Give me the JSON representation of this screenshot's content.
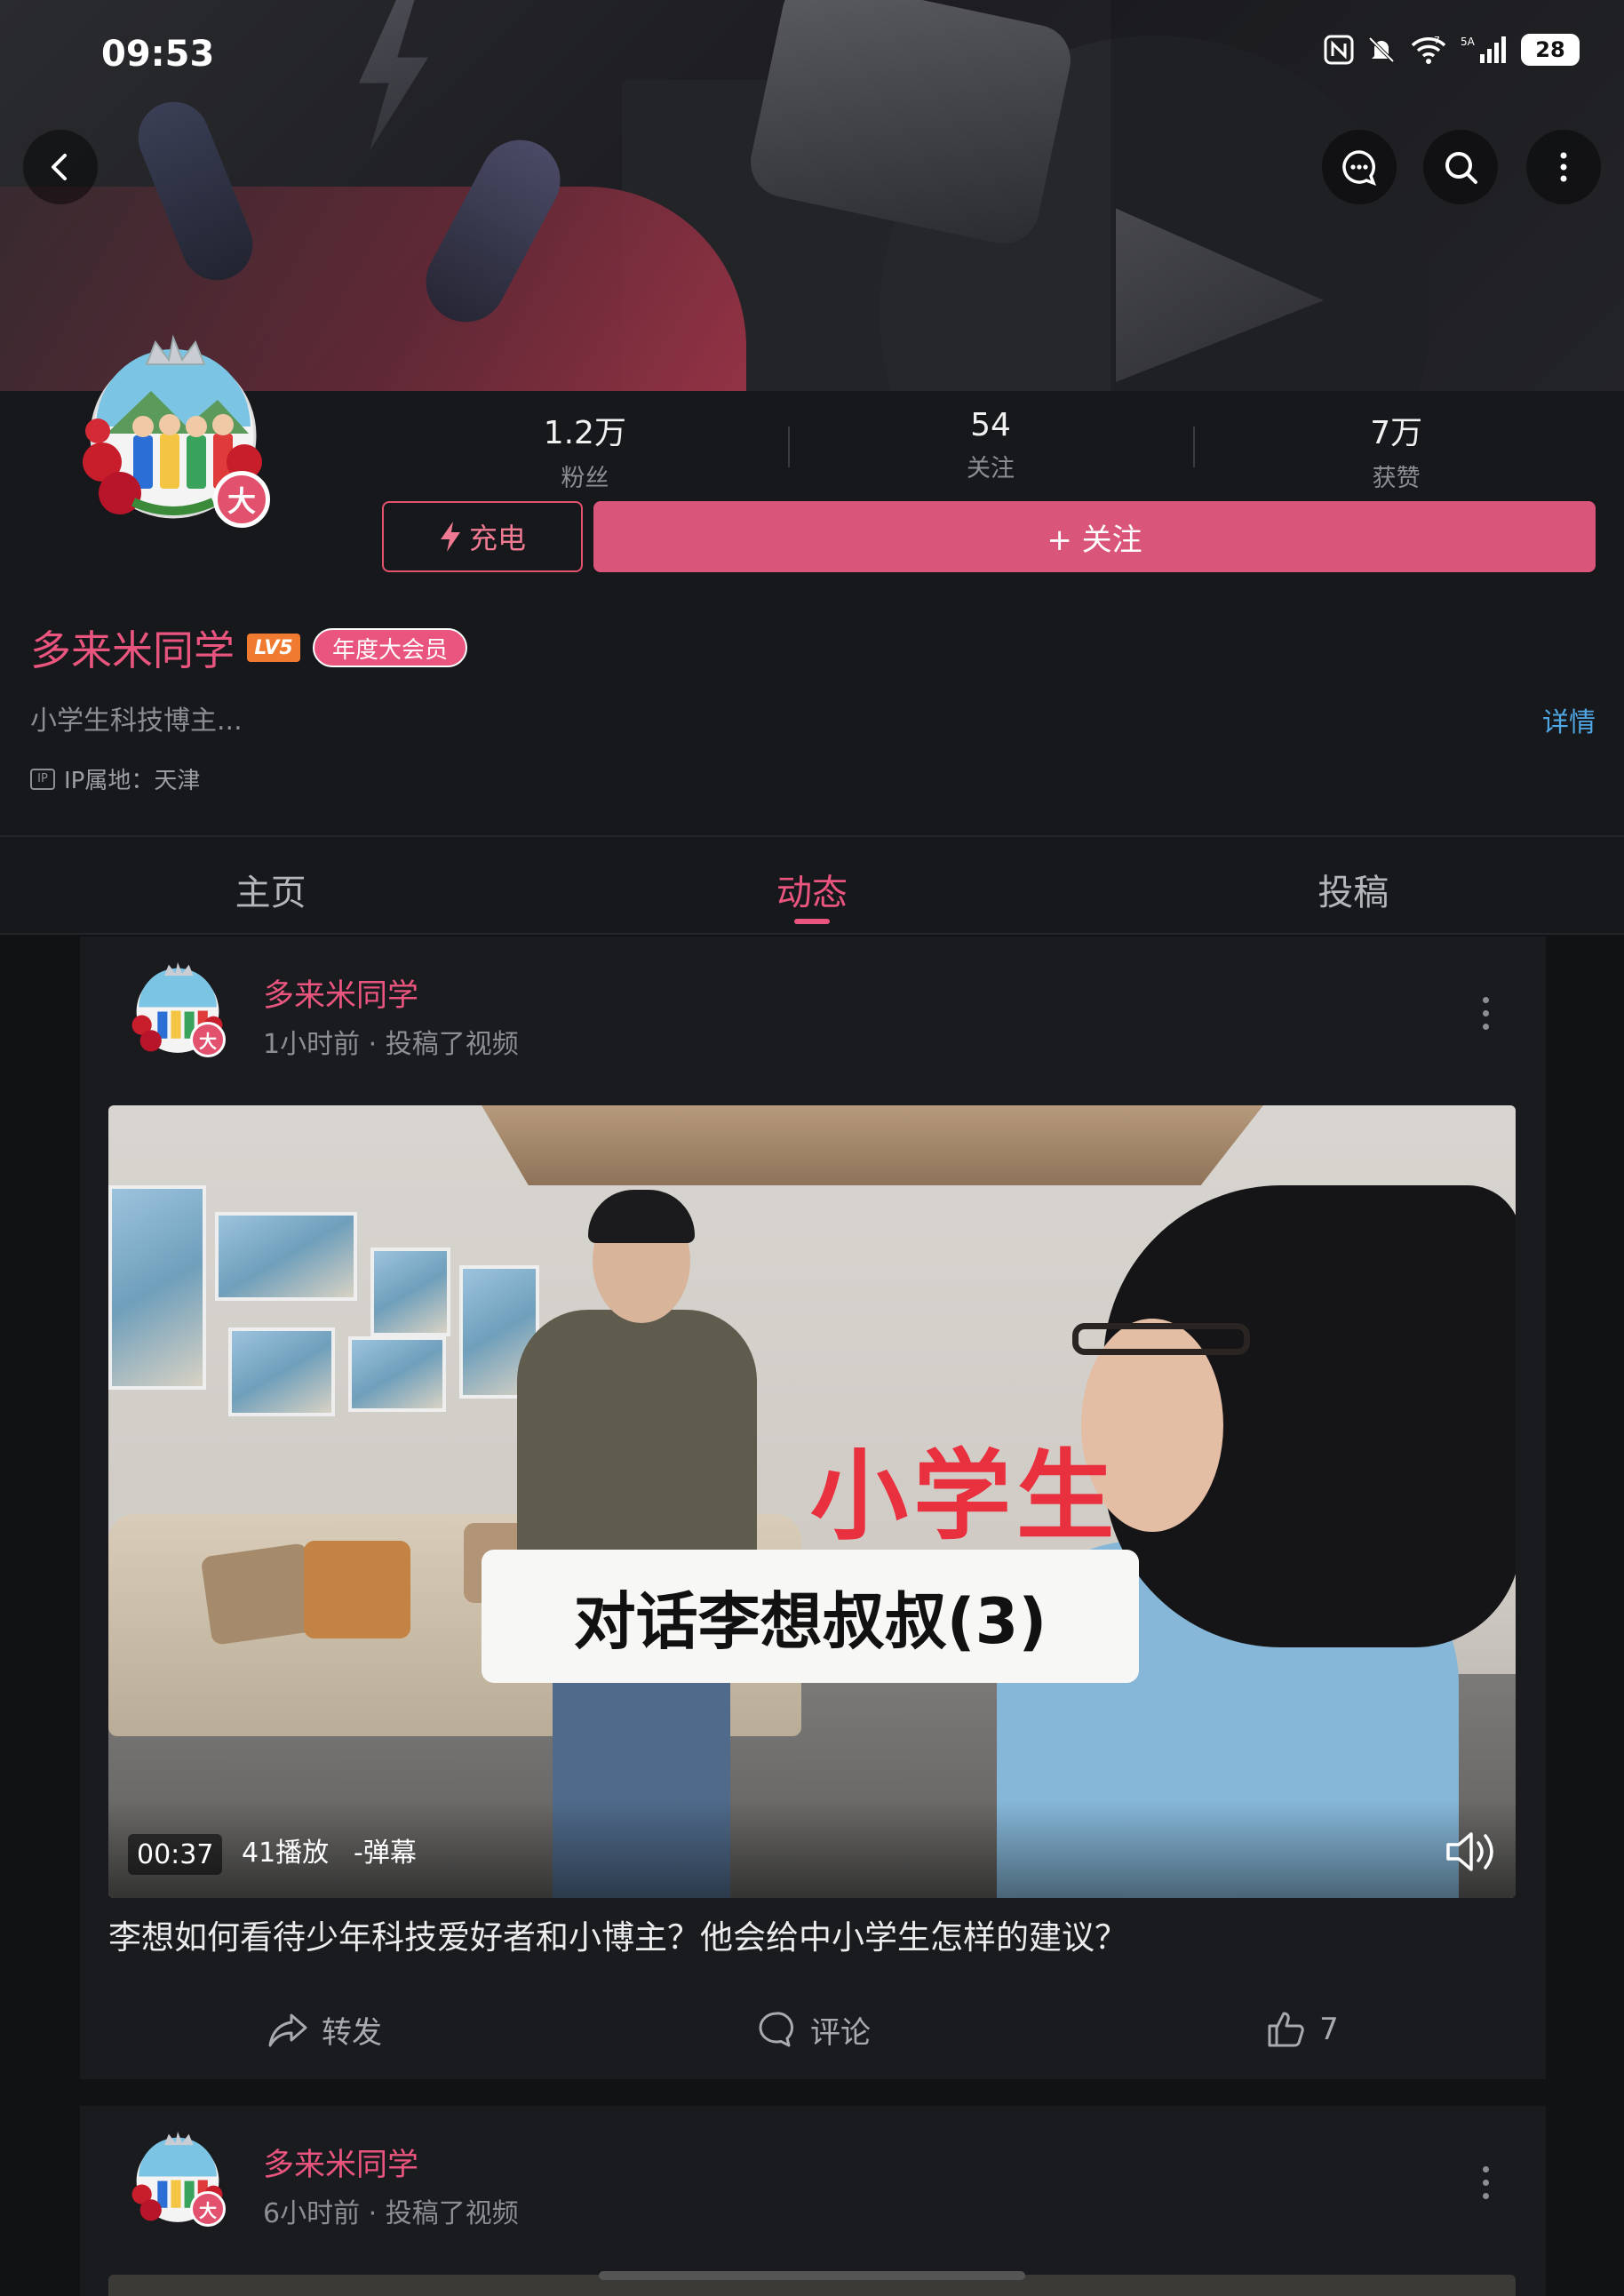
{
  "status_bar": {
    "time": "09:53",
    "icons": [
      "nfc-icon",
      "silent-bell-icon",
      "wifi-icon",
      "signal-5g-icon"
    ],
    "wifi_badge": "7",
    "network_badge": "5A",
    "battery": "28"
  },
  "top_nav": {
    "back_icon": "chevron-left-icon",
    "right_icons": [
      "chat-bubble-icon",
      "search-icon",
      "more-vertical-icon"
    ]
  },
  "profile": {
    "stats": [
      {
        "value": "1.2万",
        "label": "粉丝"
      },
      {
        "value": "54",
        "label": "关注"
      },
      {
        "value": "7万",
        "label": "获赞"
      }
    ],
    "charge_label": "充电",
    "follow_label": "+ 关注",
    "avatar_badge": "大",
    "username": "多来米同学",
    "level_badge": "LV5",
    "vip_badge": "年度大会员",
    "bio": "小学生科技博主...",
    "detail_link": "详情",
    "ip_icon_text": "IP",
    "ip_location": "IP属地：天津"
  },
  "tabs": [
    {
      "label": "主页",
      "active": false
    },
    {
      "label": "动态",
      "active": true
    },
    {
      "label": "投稿",
      "active": false
    }
  ],
  "feed": [
    {
      "username": "多来米同学",
      "meta": "1小时前 · 投稿了视频",
      "avatar_badge": "大",
      "video": {
        "title_red": "小学生",
        "title_box": "对话李想叔叔(3)",
        "duration": "00:37",
        "plays": "41播放",
        "danmaku": "-弹幕"
      },
      "text": "李想如何看待少年科技爱好者和小博主？他会给中小学生怎样的建议？",
      "actions": {
        "share": "转发",
        "comment": "评论",
        "like": "7"
      }
    },
    {
      "username": "多来米同学",
      "meta": "6小时前 · 投稿了视频",
      "avatar_badge": "大"
    }
  ],
  "colors": {
    "accent": "#e9557e",
    "follow_button": "#d9557a",
    "link": "#4fa6e3",
    "background": "#111214",
    "card": "#1a1b1e"
  }
}
